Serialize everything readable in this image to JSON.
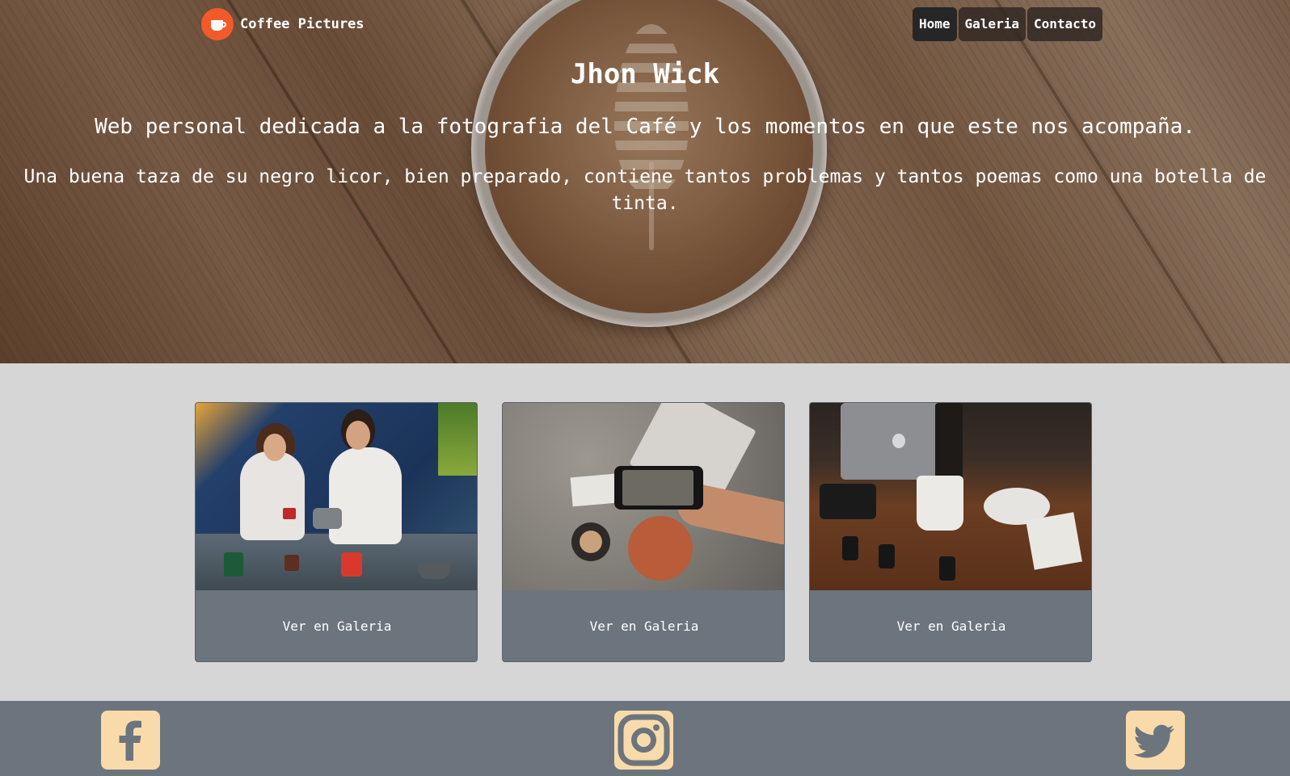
{
  "header": {
    "brand": "Coffee Pictures",
    "nav": [
      {
        "label": "Home",
        "active": true
      },
      {
        "label": "Galeria",
        "active": false
      },
      {
        "label": "Contacto",
        "active": false
      }
    ]
  },
  "hero": {
    "title": "Jhon Wick",
    "subtitle": "Web personal dedicada a la fotografia del Café y los momentos en que este nos acompaña.",
    "quote": "Una buena taza de su negro licor, bien preparado, contiene tantos problemas y tantos poemas como una botella de tinta."
  },
  "gallery": {
    "cards": [
      {
        "button": "Ver en Galeria"
      },
      {
        "button": "Ver en Galeria"
      },
      {
        "button": "Ver en Galeria"
      }
    ]
  },
  "footer": {
    "social": [
      {
        "icon": "facebook-icon"
      },
      {
        "icon": "instagram-icon"
      },
      {
        "icon": "twitter-icon"
      }
    ]
  },
  "colors": {
    "brand_logo": "#f35a2a",
    "nav_active": "#262626",
    "card_bg": "#6c757d",
    "footer_bg": "#6c757d",
    "social_bg": "#f9dbab",
    "page_bg": "#d6d6d6"
  }
}
